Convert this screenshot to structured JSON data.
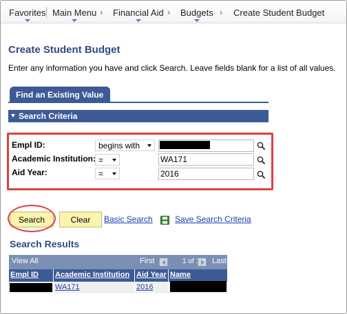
{
  "nav": {
    "favorites": "Favorites",
    "main_menu": "Main Menu",
    "financial_aid": "Financial Aid",
    "budgets": "Budgets",
    "current": "Create Student Budget"
  },
  "page": {
    "title": "Create Student Budget",
    "instruction": "Enter any information you have and click Search. Leave fields blank for a list of all values."
  },
  "tabs": {
    "find_existing": "Find an Existing Value"
  },
  "search_criteria": {
    "header": "Search Criteria",
    "fields": [
      {
        "label": "Empl ID:",
        "operator": "begins with",
        "value": ""
      },
      {
        "label": "Academic Institution:",
        "operator": "=",
        "value": "WA171"
      },
      {
        "label": "Aid Year:",
        "operator": "=",
        "value": "2016"
      }
    ]
  },
  "actions": {
    "search": "Search",
    "clear": "Clear",
    "basic_search": "Basic Search",
    "save_criteria": "Save Search Criteria"
  },
  "results": {
    "title": "Search Results",
    "view_all": "View All",
    "first": "First",
    "range": "1 of 1",
    "last": "Last",
    "columns": [
      "Empl ID",
      "Academic Institution",
      "Aid Year",
      "Name"
    ],
    "rows": [
      {
        "empl_id": "",
        "institution": "WA171",
        "aid_year": "2016",
        "name": ""
      }
    ]
  },
  "colors": {
    "brand_blue": "#3e5a96",
    "title_blue": "#304a80",
    "button_yellow": "#fbf4b0",
    "annotation_red": "#d9413f"
  }
}
